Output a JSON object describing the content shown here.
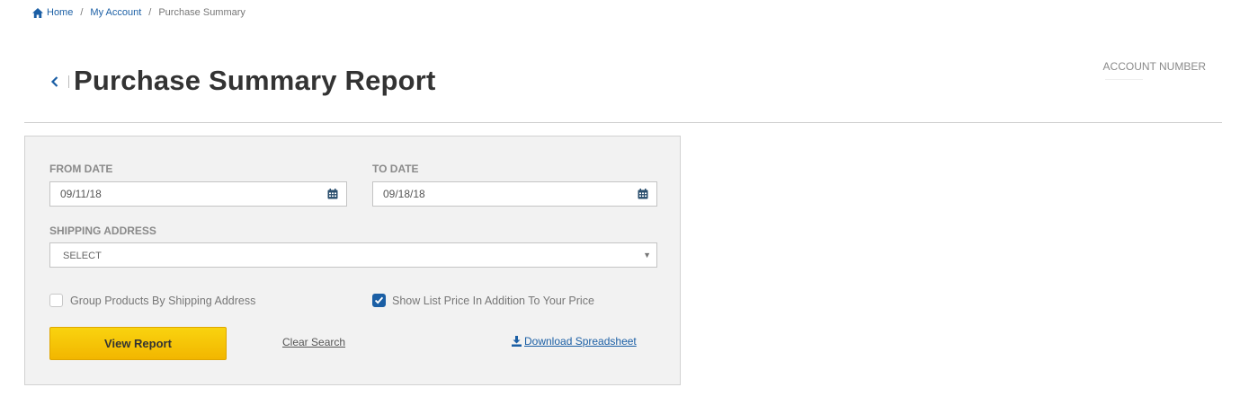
{
  "breadcrumb": {
    "home": "Home",
    "account": "My Account",
    "current": "Purchase Summary"
  },
  "header": {
    "title": "Purchase Summary Report",
    "account_label": "ACCOUNT NUMBER"
  },
  "form": {
    "from_date_label": "FROM DATE",
    "from_date_value": "09/11/18",
    "to_date_label": "TO DATE",
    "to_date_value": "09/18/18",
    "shipping_label": "SHIPPING ADDRESS",
    "shipping_value": "SELECT",
    "group_products_label": "Group Products By Shipping Address",
    "group_products_checked": false,
    "show_list_price_label": "Show List Price In Addition To Your Price",
    "show_list_price_checked": true,
    "view_report_label": "View Report",
    "clear_search_label": "Clear Search",
    "download_label": "Download Spreadsheet"
  },
  "icons": {
    "home": "home-icon",
    "back": "chevron-left-icon",
    "calendar": "calendar-icon",
    "dropdown": "caret-down-icon",
    "check": "check-icon",
    "download": "download-icon"
  },
  "colors": {
    "link": "#1b5fa5",
    "button": "#f5c400",
    "panel": "#f2f2f2"
  }
}
